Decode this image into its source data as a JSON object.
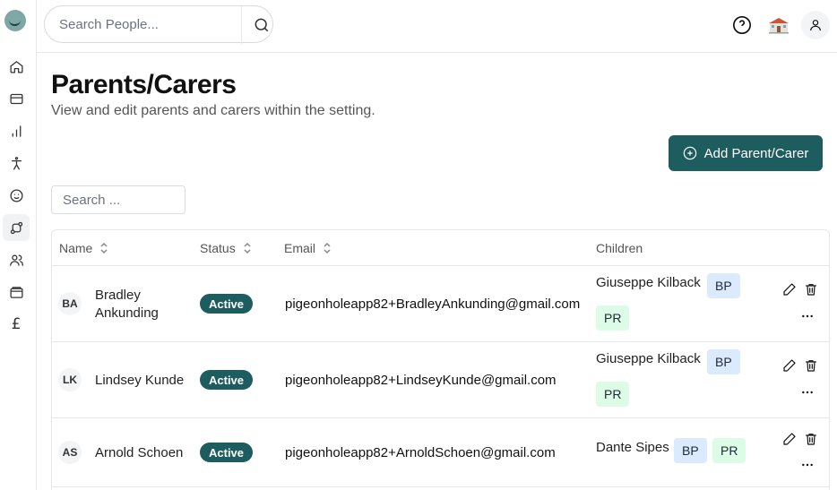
{
  "header": {
    "search_placeholder": "Search People...",
    "icons": [
      "help-circle-icon",
      "school-building-icon",
      "user-icon"
    ]
  },
  "sidebar": {
    "items": [
      "home-icon",
      "credit-card-icon",
      "bar-chart-icon",
      "child-icon",
      "baby-face-icon",
      "route-icon",
      "users-icon",
      "wallet-icon",
      "pound-icon"
    ],
    "pound_symbol": "£",
    "active": "route-icon"
  },
  "page": {
    "title": "Parents/Carers",
    "subtitle": "View and edit parents and carers within the setting.",
    "add_button": "Add Parent/Carer",
    "filter_placeholder": "Search ..."
  },
  "table": {
    "headers": {
      "name": "Name",
      "status": "Status",
      "email": "Email",
      "children": "Children"
    },
    "rows": [
      {
        "initials": "BA",
        "name": "Bradley Ankunding",
        "status": "Active",
        "email": "pigeonholeapp82+BradleyAnkunding@gmail.com",
        "child": "Giuseppe Kilback",
        "tags": [
          "BP",
          "PR"
        ]
      },
      {
        "initials": "LK",
        "name": "Lindsey Kunde",
        "status": "Active",
        "email": "pigeonholeapp82+LindseyKunde@gmail.com",
        "child": "Giuseppe Kilback",
        "tags": [
          "BP",
          "PR"
        ]
      },
      {
        "initials": "AS",
        "name": "Arnold Schoen",
        "status": "Active",
        "email": "pigeonholeapp82+ArnoldSchoen@gmail.com",
        "child": "Dante Sipes",
        "tags": [
          "BP",
          "PR"
        ]
      }
    ]
  },
  "colors": {
    "primary": "#1d5c5f",
    "bp_tag": "#dbeafe",
    "pr_tag": "#dcfce7"
  }
}
